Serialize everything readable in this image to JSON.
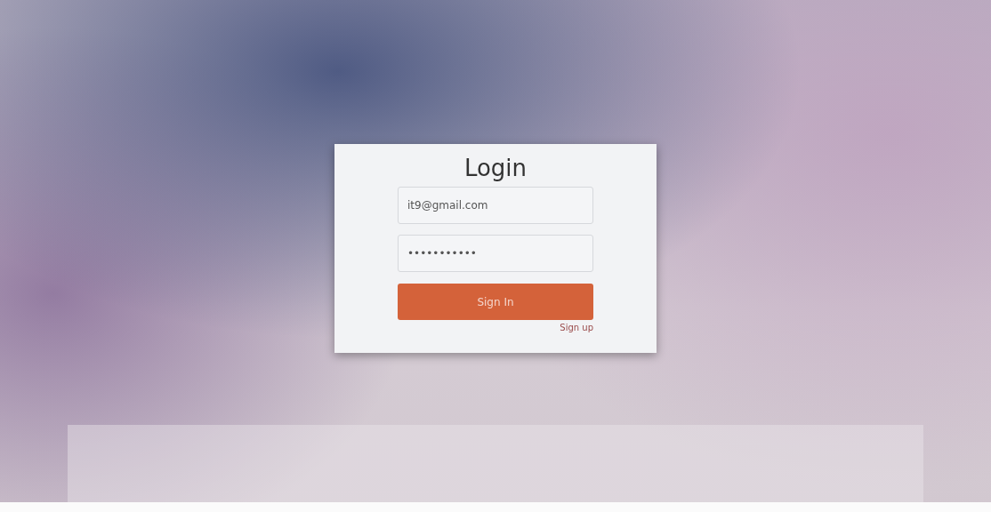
{
  "login": {
    "title": "Login",
    "email": {
      "value": "it9@gmail.com"
    },
    "password": {
      "value": "•••••••••••"
    },
    "submit": "Sign In",
    "signup_link": "Sign up"
  }
}
